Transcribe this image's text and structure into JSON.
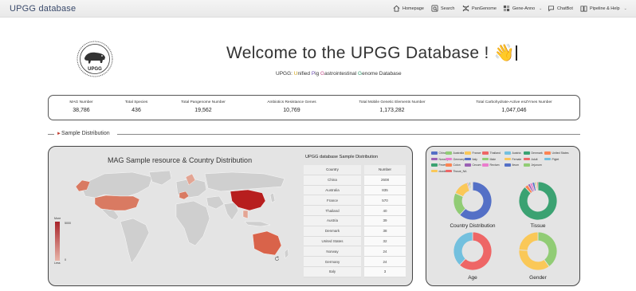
{
  "nav": {
    "brand": "UPGG database",
    "items": [
      {
        "label": "Homepage",
        "icon": "home-icon"
      },
      {
        "label": "Search",
        "icon": "search-icon"
      },
      {
        "label": "PanGenome",
        "icon": "dna-icon"
      },
      {
        "label": "Gene-Anno",
        "icon": "grid-icon"
      },
      {
        "label": "ChatBot",
        "icon": "chat-icon"
      },
      {
        "label": "Pipeline & Help",
        "icon": "book-icon"
      }
    ]
  },
  "hero": {
    "welcome": "Welcome to the UPGG Database ! 👋",
    "subtitle_prefix": "UPGG: ",
    "subtitle_parts": [
      "U",
      "nified ",
      "P",
      "ig ",
      "G",
      "astrointestinal ",
      "G",
      "enome Database"
    ],
    "logo_text": "UPGG"
  },
  "stats": [
    {
      "label": "MAG Number",
      "value": "38,786"
    },
    {
      "label": "Total Species",
      "value": "436"
    },
    {
      "label": "Total Pangenome Number",
      "value": "19,562"
    },
    {
      "label": "Ambiotics Resistance Genes",
      "value": "10,769"
    },
    {
      "label": "Total Mobile Genetic Elements Number",
      "value": "1,173,282"
    },
    {
      "label": "Total Carbohydrate-Active enZYmes Number",
      "value": "1,047,046"
    }
  ],
  "section": {
    "title": "Sample Distribution"
  },
  "map": {
    "title": "MAG Sample resource & Country Distribution",
    "legend_more": "More",
    "legend_less": "Less",
    "legend_max": "5000",
    "legend_min": "0"
  },
  "table": {
    "title": "UPGG database Sample Distribution",
    "headers": [
      "Country",
      "Number"
    ],
    "rows": [
      [
        "China",
        "2608"
      ],
      [
        "Australia",
        "835"
      ],
      [
        "France",
        "570"
      ],
      [
        "Thailand",
        "40"
      ],
      [
        "Austria",
        "39"
      ],
      [
        "Denmark",
        "38"
      ],
      [
        "United States",
        "32"
      ],
      [
        "Norway",
        "24"
      ],
      [
        "Germany",
        "24"
      ],
      [
        "Italy",
        "3"
      ]
    ]
  },
  "legend_items": [
    {
      "label": "China",
      "color": "#5470c6"
    },
    {
      "label": "Australia",
      "color": "#91cc75"
    },
    {
      "label": "France",
      "color": "#fac858"
    },
    {
      "label": "Thailand",
      "color": "#ee6666"
    },
    {
      "label": "Austria",
      "color": "#73c0de"
    },
    {
      "label": "Denmark",
      "color": "#3ba272"
    },
    {
      "label": "United States",
      "color": "#fc8452"
    },
    {
      "label": "Norway",
      "color": "#9a60b4"
    },
    {
      "label": "Germany",
      "color": "#ea7ccc"
    },
    {
      "label": "Italy",
      "color": "#5470c6"
    },
    {
      "label": "Male",
      "color": "#91cc75"
    },
    {
      "label": "Female",
      "color": "#fac858"
    },
    {
      "label": "Adult",
      "color": "#ee6666"
    },
    {
      "label": "Piglet",
      "color": "#73c0de"
    },
    {
      "label": "Feces",
      "color": "#3ba272"
    },
    {
      "label": "Colon",
      "color": "#fc8452"
    },
    {
      "label": "Cecum",
      "color": "#9a60b4"
    },
    {
      "label": "Rectum",
      "color": "#ea7ccc"
    },
    {
      "label": "Ileum",
      "color": "#5470c6"
    },
    {
      "label": "Jejunum",
      "color": "#91cc75"
    },
    {
      "label": "duodenum",
      "color": "#fac858"
    },
    {
      "label": "Tissue_NA",
      "color": "#ee6666"
    }
  ],
  "chart_data": [
    {
      "type": "pie",
      "title": "Country Distribution",
      "categories": [
        "China",
        "Australia",
        "France",
        "Thailand",
        "Austria",
        "Denmark",
        "United States",
        "Norway",
        "Germany",
        "Italy"
      ],
      "values": [
        2608,
        835,
        570,
        40,
        39,
        38,
        32,
        24,
        24,
        3
      ]
    },
    {
      "type": "pie",
      "title": "Tissue",
      "categories": [
        "Feces",
        "Colon",
        "Cecum",
        "Rectum",
        "Ileum",
        "Jejunum",
        "duodenum",
        "Tissue_NA"
      ],
      "values": [
        88,
        3,
        2,
        2,
        2,
        1,
        1,
        1
      ]
    },
    {
      "type": "pie",
      "title": "Age",
      "categories": [
        "Adult",
        "Piglet"
      ],
      "values": [
        62,
        38
      ]
    },
    {
      "type": "pie",
      "title": "Gender",
      "categories": [
        "Male",
        "Female",
        "Gender_NA"
      ],
      "values": [
        40,
        36,
        24
      ]
    }
  ]
}
